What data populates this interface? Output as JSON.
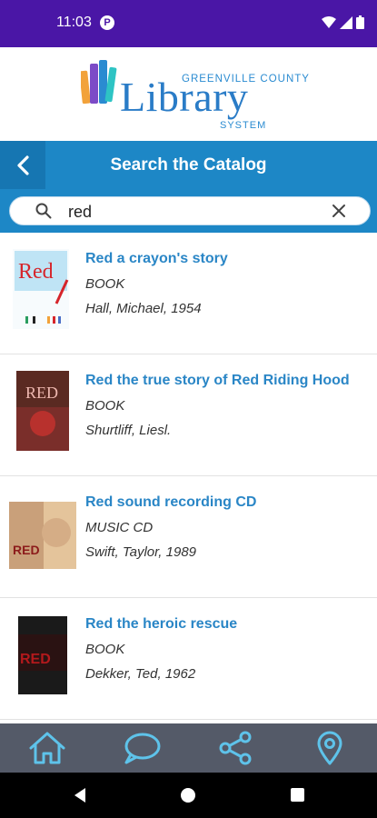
{
  "status_bar": {
    "time": "11:03",
    "app_icon": "P",
    "icons": [
      "wifi-icon",
      "signal-icon",
      "battery-icon"
    ]
  },
  "logo": {
    "line1": "GREENVILLE COUNTY",
    "line2": "Library",
    "line3": "SYSTEM",
    "colors": [
      "#f2a23a",
      "#7c4bc7",
      "#2a8bd1",
      "#2ec4c4"
    ]
  },
  "header": {
    "title": "Search the Catalog"
  },
  "search": {
    "value": "red",
    "placeholder": ""
  },
  "results": [
    {
      "title": "Red a crayon's story",
      "format": "BOOK",
      "author": "Hall, Michael, 1954",
      "cover_text": "Red"
    },
    {
      "title": "Red the true story of Red Riding Hood",
      "format": "BOOK",
      "author": "Shurtliff, Liesl.",
      "cover_text": "RED"
    },
    {
      "title": "Red sound recording CD",
      "format": "MUSIC CD",
      "author": "Swift, Taylor, 1989",
      "cover_text": "RED"
    },
    {
      "title": "Red the heroic rescue",
      "format": "BOOK",
      "author": "Dekker, Ted, 1962",
      "cover_text": "RED"
    }
  ],
  "bottom_nav": {
    "items": [
      "home-icon",
      "chat-icon",
      "share-icon",
      "location-icon"
    ],
    "color": "#5ec3ea"
  }
}
